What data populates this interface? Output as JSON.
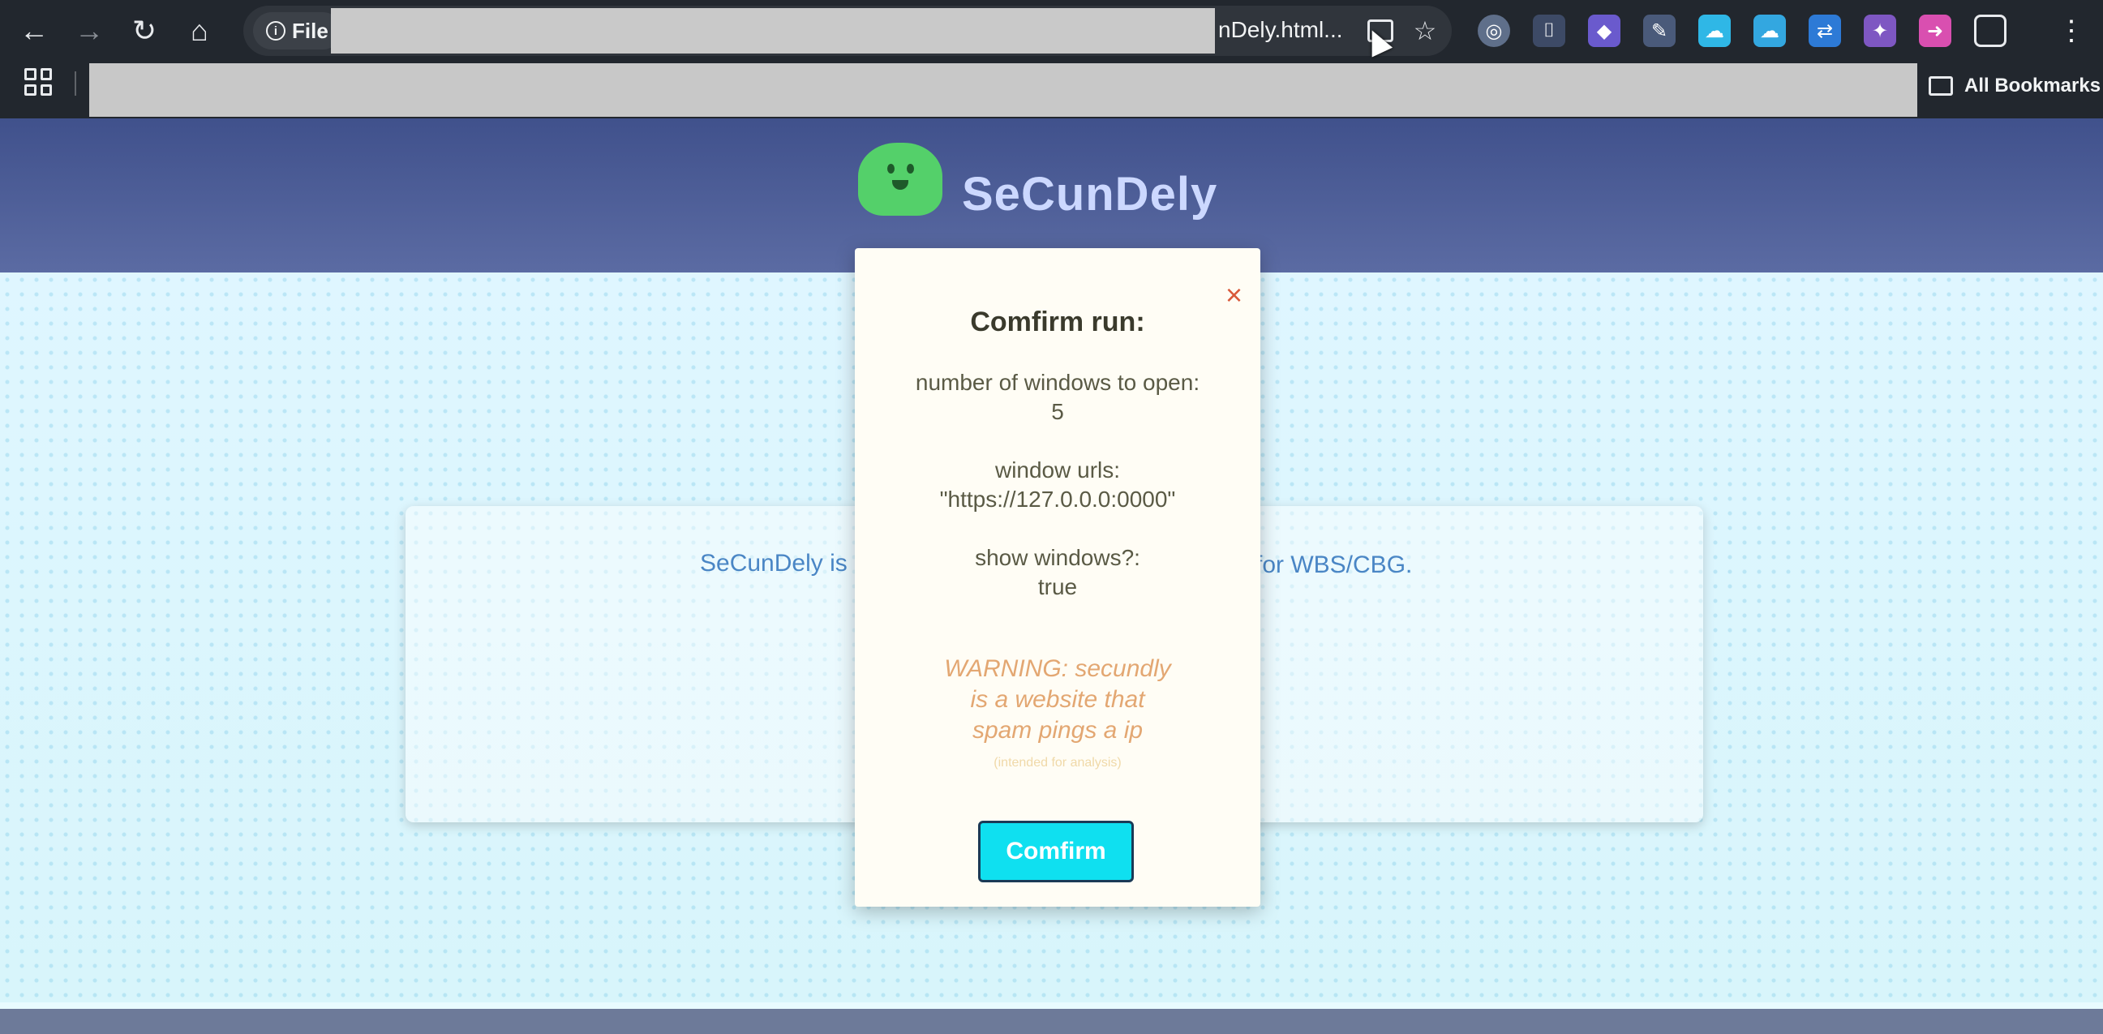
{
  "browser": {
    "file_chip_label": "File",
    "url_visible_tail": "nDely.html...",
    "all_bookmarks_label": "All Bookmarks",
    "icons": [
      "back-icon",
      "forward-icon",
      "reload-icon",
      "home-icon",
      "info-icon",
      "tab-cast-icon",
      "star-icon",
      "apps-icon",
      "folder-icon",
      "more-icon"
    ]
  },
  "site": {
    "title": "SeCunDely",
    "card_text_left": "SeCunDely is",
    "card_text_right": "for WBS/CBG."
  },
  "modal": {
    "close_glyph": "×",
    "title": "Comfirm run:",
    "windows_label": "number of windows to open:",
    "windows_value": "5",
    "urls_label": "window urls:",
    "urls_value": "\"https://127.0.0.0:0000\"",
    "show_label": "show windows?:",
    "show_value": "true",
    "warning_line1": "WARNING: secundly",
    "warning_line2": "is a website that",
    "warning_line3": "spam pings a ip",
    "warning_note": "(intended for analysis)",
    "confirm_label": "Comfirm"
  },
  "colors": {
    "header": "#40518c",
    "confirm_button": "#0fe0f0",
    "close": "#d9593a",
    "warning": "#e3a772"
  }
}
